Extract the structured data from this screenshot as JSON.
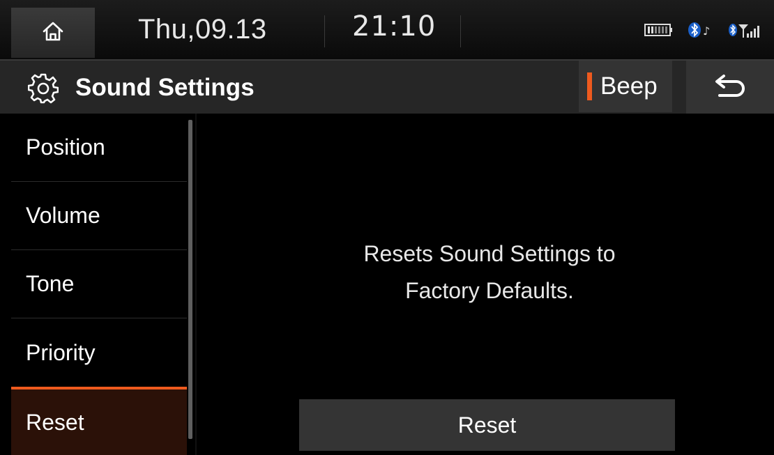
{
  "statusbar": {
    "date": "Thu,09.13",
    "time": "21:10",
    "icons": [
      "home-icon",
      "battery-icon",
      "bluetooth-audio-icon",
      "bluetooth-signal-icon"
    ]
  },
  "titlebar": {
    "title": "Sound Settings",
    "beep_label": "Beep",
    "icons": [
      "gear-icon",
      "back-arrow-icon"
    ]
  },
  "sidebar": {
    "items": [
      {
        "label": "Position"
      },
      {
        "label": "Volume"
      },
      {
        "label": "Tone"
      },
      {
        "label": "Priority"
      },
      {
        "label": "Reset",
        "active": true
      }
    ]
  },
  "content": {
    "message_line1": "Resets Sound Settings to",
    "message_line2": "Factory Defaults.",
    "reset_button": "Reset"
  },
  "colors": {
    "accent": "#ee5a1e",
    "background": "#000000",
    "bar": "#262626",
    "active_item": "#2b1108"
  }
}
